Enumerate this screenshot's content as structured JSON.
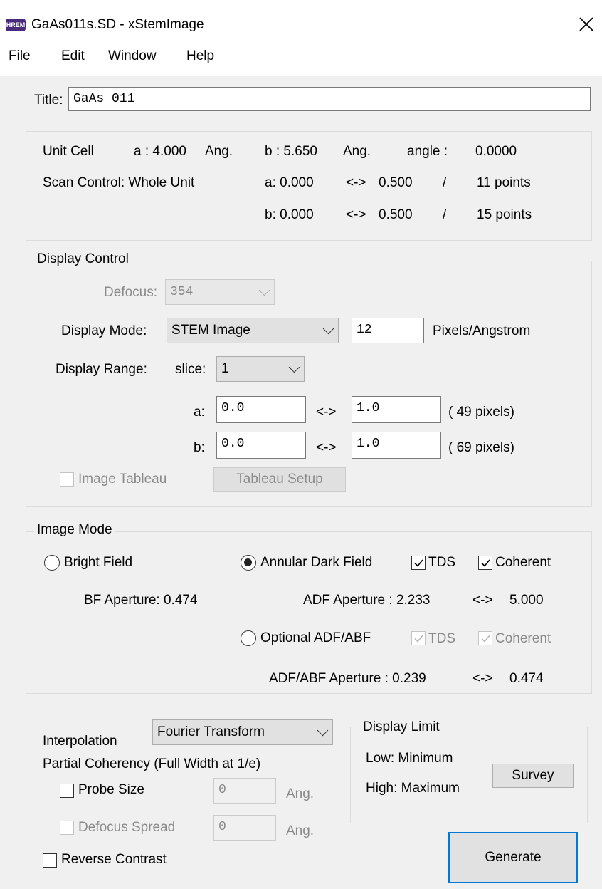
{
  "window": {
    "title": "GaAs011s.SD - xStemImage",
    "app_icon": "HREM"
  },
  "menu": [
    "File",
    "Edit",
    "Window",
    "Help"
  ],
  "title_field": {
    "label": "Title:",
    "value": "GaAs 011"
  },
  "unit_cell": {
    "label": "Unit Cell",
    "a": "a : 4.000",
    "a_unit": "Ang.",
    "b": "b : 5.650",
    "b_unit": "Ang.",
    "angle_label": "angle :",
    "angle": "0.0000"
  },
  "scan_control": {
    "label": "Scan Control: Whole Unit",
    "a_range": "a: 0.000",
    "a_arrow": "<->",
    "a_end": "0.500",
    "a_sep": "/",
    "a_points": "11 points",
    "b_range": "b: 0.000",
    "b_arrow": "<->",
    "b_end": "0.500",
    "b_sep": "/",
    "b_points": "15 points"
  },
  "display_control": {
    "legend": "Display Control",
    "defocus_label": "Defocus:",
    "defocus_value": "354",
    "mode_label": "Display Mode:",
    "mode_value": "STEM Image",
    "pixels_value": "12",
    "pixels_unit": "Pixels/Angstrom",
    "range_label": "Display Range:",
    "slice_label": "slice:",
    "slice_value": "1",
    "a_label": "a:",
    "a_start": "0.0",
    "a_arrow": "<->",
    "a_end": "1.0",
    "a_pixels": "( 49 pixels)",
    "b_label": "b:",
    "b_start": "0.0",
    "b_arrow": "<->",
    "b_end": "1.0",
    "b_pixels": "( 69 pixels)",
    "tableau_label": "Image Tableau",
    "tableau_button": "Tableau Setup"
  },
  "image_mode": {
    "legend": "Image Mode",
    "bf_label": "Bright Field",
    "bf_aperture": "BF Aperture: 0.474",
    "adf_label": "Annular Dark Field",
    "tds_label": "TDS",
    "coherent_label": "Coherent",
    "adf_aperture": "ADF Aperture : 2.233",
    "adf_arrow": "<->",
    "adf_end": "5.000",
    "opt_label": "Optional ADF/ABF",
    "opt_tds_label": "TDS",
    "opt_coherent_label": "Coherent",
    "opt_aperture": "ADF/ABF Aperture : 0.239",
    "opt_arrow": "<->",
    "opt_end": "0.474"
  },
  "interpolation": {
    "label": "Interpolation",
    "value": "Fourier Transform"
  },
  "coherency": {
    "label": "Partial Coherency (Full Width at 1/e)",
    "probe_label": "Probe Size",
    "probe_value": "0",
    "probe_unit": "Ang.",
    "spread_label": "Defocus Spread",
    "spread_value": "0",
    "spread_unit": "Ang."
  },
  "reverse_contrast": "Reverse Contrast",
  "display_limit": {
    "legend": "Display Limit",
    "low": "Low:  Minimum",
    "high": "High: Maximum",
    "survey": "Survey"
  },
  "generate": "Generate"
}
